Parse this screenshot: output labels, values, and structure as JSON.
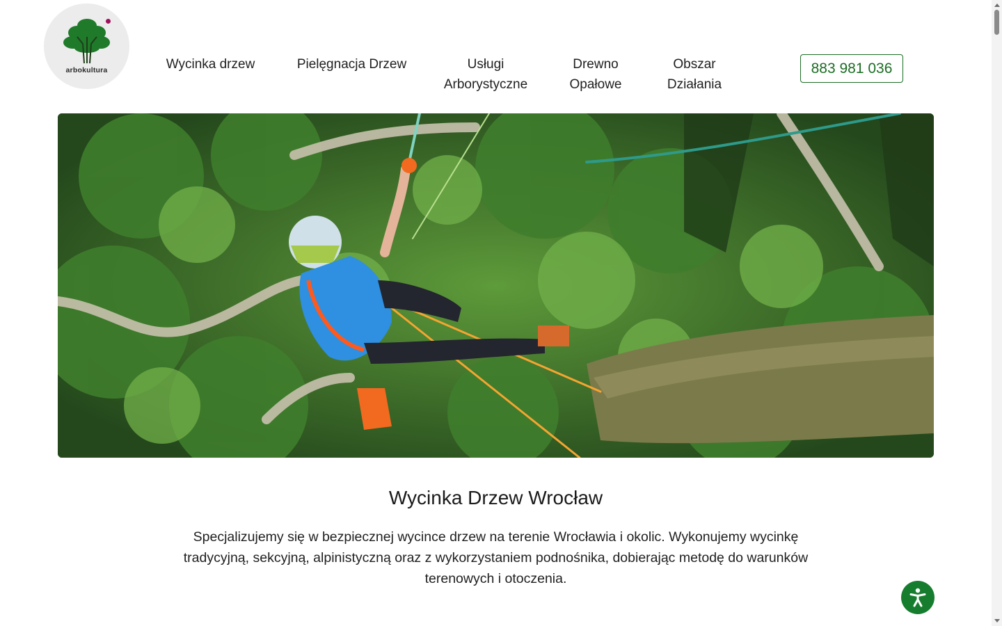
{
  "header": {
    "logo_text": "arbokultura",
    "nav": [
      {
        "line1": "Wycinka drzew",
        "line2": ""
      },
      {
        "line1": "Pielęgnacja Drzew",
        "line2": ""
      },
      {
        "line1": "Usługi",
        "line2": "Arborystyczne"
      },
      {
        "line1": "Drewno",
        "line2": "Opałowe"
      },
      {
        "line1": "Obszar",
        "line2": "Działania"
      }
    ],
    "phone": "883 981 036"
  },
  "main": {
    "title": "Wycinka Drzew Wrocław",
    "lead": "Specjalizujemy się w bezpiecznej wycince drzew na terenie Wrocławia i okolic. Wykonujemy wycinkę tradycyjną, sekcyjną, alpinistyczną oraz z wykorzystaniem podnośnika, dobierając metodę do warunków terenowych i otoczenia."
  },
  "colors": {
    "brand_green": "#1b6d23",
    "accessibility_button": "#177d2e",
    "logo_dot": "#a1115e"
  },
  "icons": {
    "accessibility": "accessibility-person-icon"
  }
}
